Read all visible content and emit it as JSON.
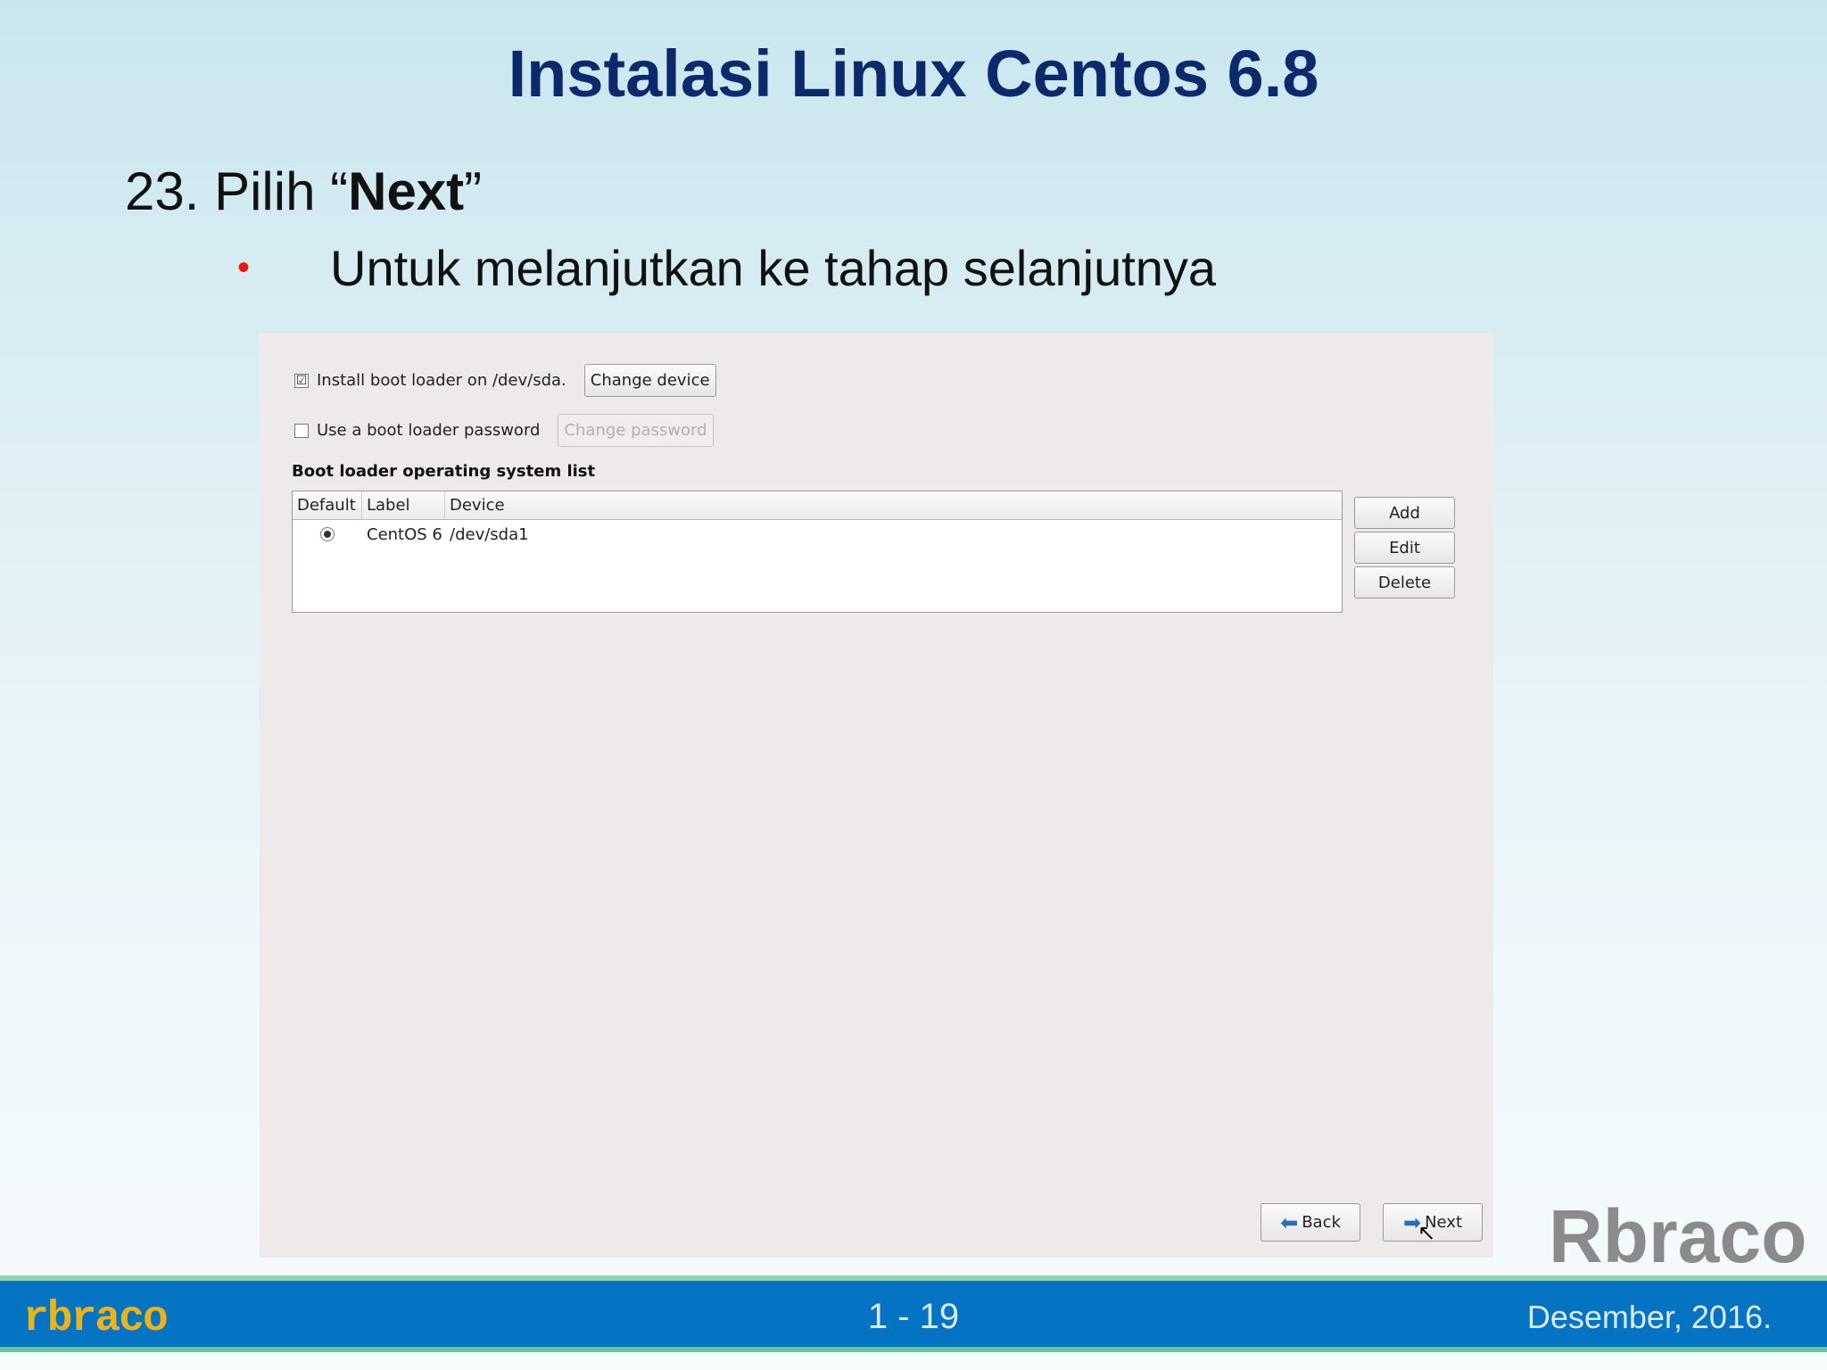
{
  "slide": {
    "title": "Instalasi Linux Centos 6.8",
    "step_prefix": "23. Pilih “",
    "step_bold": "Next",
    "step_suffix": "”",
    "bullet": "•",
    "bullet_text": "Untuk melanjutkan ke tahap selanjutnya",
    "watermark": "Rbraco"
  },
  "installer": {
    "install_bootloader": {
      "checked": true,
      "label": "Install boot loader on /dev/sda.",
      "check_glyph": "☑"
    },
    "change_device_label": "Change device",
    "bootloader_password": {
      "checked": false,
      "label": "Use a boot loader password"
    },
    "change_password_label": "Change password",
    "os_list_title": "Boot loader operating system list",
    "table": {
      "columns": [
        "Default",
        "Label",
        "Device"
      ],
      "rows": [
        {
          "default": true,
          "label": "CentOS 6",
          "device": "/dev/sda1"
        }
      ]
    },
    "side_buttons": {
      "add": "Add",
      "edit": "Edit",
      "delete": "Delete"
    },
    "nav": {
      "back": "Back",
      "next": "Next"
    }
  },
  "footer": {
    "logo": "rbraco",
    "page": "1 - 19",
    "date": "Desember, 2016."
  },
  "colors": {
    "title": "#0b2a6b",
    "bullet": "#e4181b",
    "footer_bg": "#0474c2",
    "footer_logo": "#e8b41a"
  }
}
